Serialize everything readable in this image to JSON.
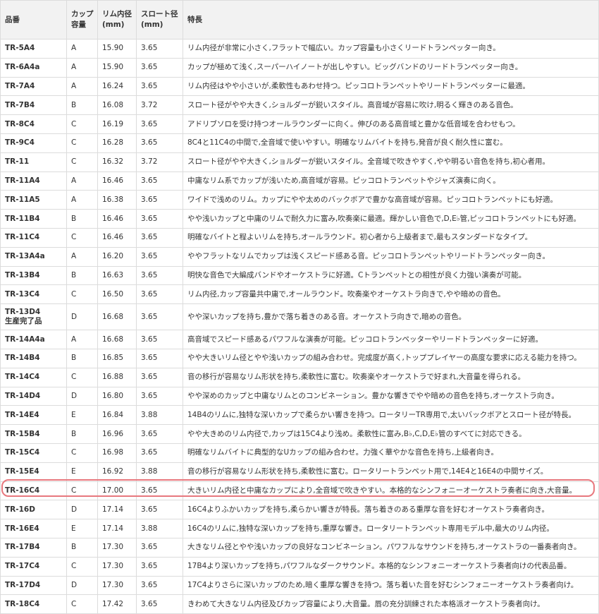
{
  "headers": {
    "code": "品番",
    "cup_line1": "カップ",
    "cup_line2": "容量",
    "rim_line1": "リム内径",
    "rim_line2": "(mm)",
    "throat_line1": "スロート径",
    "throat_line2": "(mm)",
    "feature": "特長"
  },
  "rows": [
    {
      "code": "TR-5A4",
      "cup": "A",
      "rim": "15.90",
      "throat": "3.65",
      "feature": "リム内径が非常に小さく,フラットで幅広い。カップ容量も小さくリードトランペッター向き。"
    },
    {
      "code": "TR-6A4a",
      "cup": "A",
      "rim": "15.90",
      "throat": "3.65",
      "feature": "カップが極めて浅く,スーパーハイノートが出しやすい。ビッグバンドのリードトランペッター向き。"
    },
    {
      "code": "TR-7A4",
      "cup": "A",
      "rim": "16.24",
      "throat": "3.65",
      "feature": "リム内径はやや小さいが,柔軟性もあわせ持つ。ピッコロトランペットやリードトランペッターに最適。"
    },
    {
      "code": "TR-7B4",
      "cup": "B",
      "rim": "16.08",
      "throat": "3.72",
      "feature": "スロート径がやや大きく,ショルダーが鋭いスタイル。高音域が容易に吹け,明るく輝きのある音色。"
    },
    {
      "code": "TR-8C4",
      "cup": "C",
      "rim": "16.19",
      "throat": "3.65",
      "feature": "アドリブソロを受け持つオールラウンダーに向く。伸びのある高音域と豊かな低音域を合わせもつ。"
    },
    {
      "code": "TR-9C4",
      "cup": "C",
      "rim": "16.28",
      "throat": "3.65",
      "feature": "8C4と11C4の中間で,全音域で使いやすい。明確なリムバイトを持ち,発音が良く耐久性に富む。"
    },
    {
      "code": "TR-11",
      "cup": "C",
      "rim": "16.32",
      "throat": "3.72",
      "feature": "スロート径がやや大きく,ショルダーが鋭いスタイル。全音域で吹きやすく,やや明るい音色を持ち,初心者用。"
    },
    {
      "code": "TR-11A4",
      "cup": "A",
      "rim": "16.46",
      "throat": "3.65",
      "feature": "中庸なリム系でカップが浅いため,高音域が容易。ピッコロトランペットやジャズ演奏に向く。"
    },
    {
      "code": "TR-11A5",
      "cup": "A",
      "rim": "16.38",
      "throat": "3.65",
      "feature": "ワイドで浅めのリム。カップにやや太めのバックボアで豊かな高音域が容易。ピッコロトランペットにも好適。"
    },
    {
      "code": "TR-11B4",
      "cup": "B",
      "rim": "16.46",
      "throat": "3.65",
      "feature": "やや浅いカップと中庸のリムで耐久力に富み,吹奏楽に最適。輝かしい音色で,D,E♭管,ピッコロトランペットにも好適。"
    },
    {
      "code": "TR-11C4",
      "cup": "C",
      "rim": "16.46",
      "throat": "3.65",
      "feature": "明確なバイトと程よいリムを持ち,オールラウンド。初心者から上級者まで,最もスタンダードなタイプ。"
    },
    {
      "code": "TR-13A4a",
      "cup": "A",
      "rim": "16.20",
      "throat": "3.65",
      "feature": "ややフラットなリムでカップは浅くスピード感ある音。ピッコロトランペットやリードトランペッター向き。"
    },
    {
      "code": "TR-13B4",
      "cup": "B",
      "rim": "16.63",
      "throat": "3.65",
      "feature": "明快な音色で大編成バンドやオーケストラに好適。Cトランペットとの相性が良く力強い演奏が可能。"
    },
    {
      "code": "TR-13C4",
      "cup": "C",
      "rim": "16.50",
      "throat": "3.65",
      "feature": "リム内径,カップ容量共中庸で,オールラウンド。吹奏楽やオーケストラ向きで,やや暗めの音色。"
    },
    {
      "code": "TR-13D4",
      "code2": "生産完了品",
      "cup": "D",
      "rim": "16.68",
      "throat": "3.65",
      "feature": "やや深いカップを持ち,豊かで落ち着きのある音。オーケストラ向きで,暗めの音色。"
    },
    {
      "code": "TR-14A4a",
      "cup": "A",
      "rim": "16.68",
      "throat": "3.65",
      "feature": "高音域でスピード感あるパワフルな演奏が可能。ピッコロトランペッターやリードトランペッターに好適。"
    },
    {
      "code": "TR-14B4",
      "cup": "B",
      "rim": "16.85",
      "throat": "3.65",
      "feature": "やや大きいリム径とやや浅いカップの組み合わせ。完成度が高く,トッププレイヤーの高度な要求に応える能力を持つ。"
    },
    {
      "code": "TR-14C4",
      "cup": "C",
      "rim": "16.88",
      "throat": "3.65",
      "feature": "音の移行が容易なリム形状を持ち,柔軟性に富む。吹奏楽やオーケストラで好まれ,大音量を得られる。"
    },
    {
      "code": "TR-14D4",
      "cup": "D",
      "rim": "16.80",
      "throat": "3.65",
      "feature": "やや深めのカップと中庸なリムとのコンビネーション。豊かな響きでやや暗めの音色を持ち,オーケストラ向き。"
    },
    {
      "code": "TR-14E4",
      "cup": "E",
      "rim": "16.84",
      "throat": "3.88",
      "feature": "14B4のリムに,独特な深いカップで柔らかい響きを持つ。ロータリーTR専用で,太いバックボアとスロート径が特長。"
    },
    {
      "code": "TR-15B4",
      "cup": "B",
      "rim": "16.96",
      "throat": "3.65",
      "feature": "やや大きめのリム内径で,カップは15C4より浅め。柔軟性に富み,B♭,C,D,E♭管のすべてに対応できる。"
    },
    {
      "code": "TR-15C4",
      "cup": "C",
      "rim": "16.98",
      "throat": "3.65",
      "feature": "明確なリムバイトに典型的なUカップの組み合わせ。力強く華やかな音色を持ち,上級者向き。"
    },
    {
      "code": "TR-15E4",
      "cup": "E",
      "rim": "16.92",
      "throat": "3.88",
      "feature": "音の移行が容易なリム形状を持ち,柔軟性に富む。ロータリートランペット用で,14E4と16E4の中間サイズ。"
    },
    {
      "code": "TR-16C4",
      "cup": "C",
      "rim": "17.00",
      "throat": "3.65",
      "feature": "大きいリム内径と中庸なカップにより,全音域で吹きやすい。本格的なシンフォニーオーケストラ奏者に向き,大音量。"
    },
    {
      "code": "TR-16D",
      "cup": "D",
      "rim": "17.14",
      "throat": "3.65",
      "feature": "16C4よりふかいカップを持ち,柔らかい響きが特長。落ち着きのある重厚な音を好むオーケストラ奏者向き。"
    },
    {
      "code": "TR-16E4",
      "cup": "E",
      "rim": "17.14",
      "throat": "3.88",
      "feature": "16C4のリムに,独特な深いカップを持ち,重厚な響き。ロータリートランペット専用モデル中,最大のリム内径。"
    },
    {
      "code": "TR-17B4",
      "cup": "B",
      "rim": "17.30",
      "throat": "3.65",
      "feature": "大きなリム径とやや浅いカップの良好なコンビネーション。パワフルなサウンドを持ち,オーケストラの一番奏者向き。"
    },
    {
      "code": "TR-17C4",
      "cup": "C",
      "rim": "17.30",
      "throat": "3.65",
      "feature": "17B4より深いカップを持ち,パワフルなダークサウンド。本格的なシンフォニーオーケストラ奏者向けの代表品番。"
    },
    {
      "code": "TR-17D4",
      "cup": "D",
      "rim": "17.30",
      "throat": "3.65",
      "feature": "17C4よりさらに深いカップのため,暗く重厚な響きを持つ。落ち着いた音を好むシンフォニーオーケストラ奏者向け。"
    },
    {
      "code": "TR-18C4",
      "cup": "C",
      "rim": "17.42",
      "throat": "3.65",
      "feature": "きわめて大きなリム内径及びカップ容量により,大音量。唇の充分訓練された本格派オーケストラ奏者向け。"
    }
  ],
  "colors": {
    "header_bg": "#f2f2f2",
    "border": "#dcdcdc",
    "highlight_border": "#e8787e",
    "text": "#333333"
  }
}
